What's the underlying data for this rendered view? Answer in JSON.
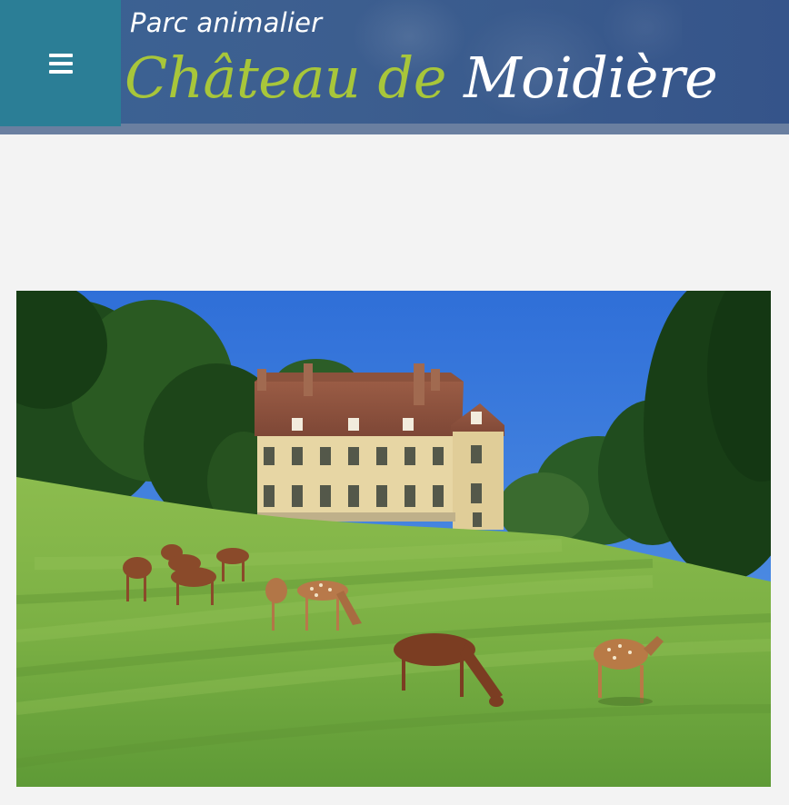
{
  "header": {
    "subtitle": "Parc animalier",
    "title_part1": "Château de",
    "title_part2": "Moidière",
    "menu_icon": "hamburger-menu-icon",
    "colors": {
      "menu_bg": "#2b7e96",
      "header_bg": "#3a5b8d",
      "title_green": "#a8c63a",
      "title_white": "#ffffff"
    }
  },
  "main": {
    "hero_image": "chateau-deer-meadow-photo"
  }
}
